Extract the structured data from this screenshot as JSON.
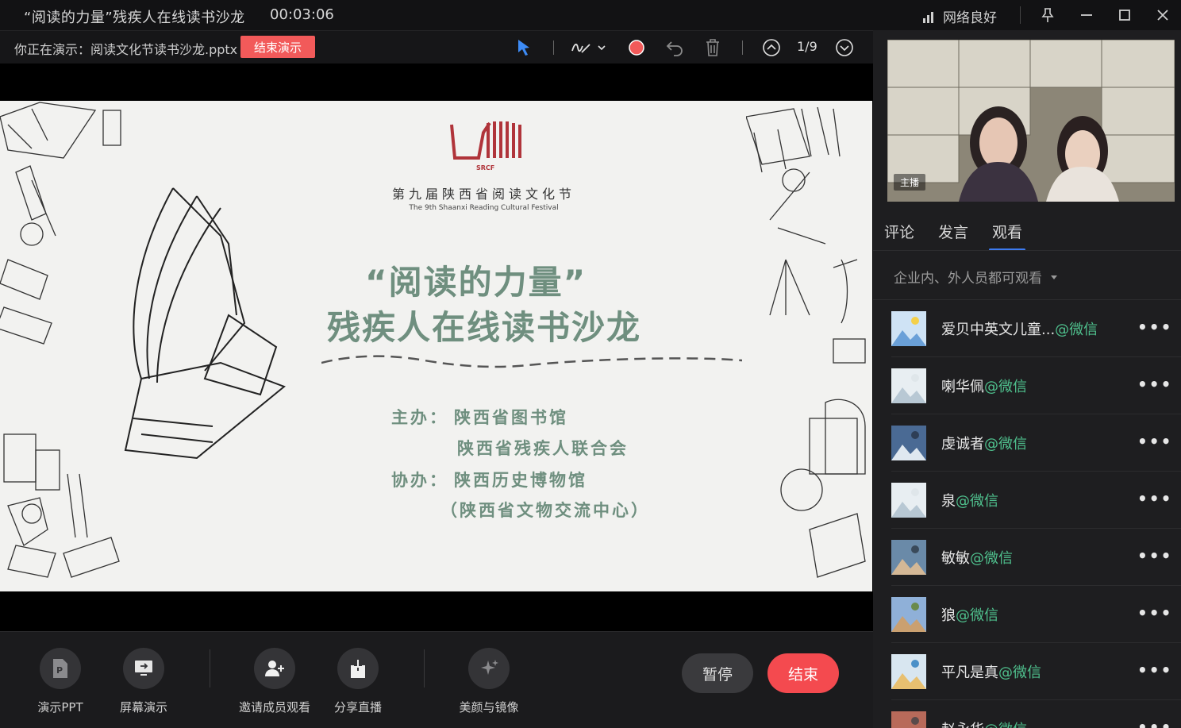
{
  "titlebar": {
    "title": "“阅读的力量”残疾人在线读书沙龙",
    "time": "00:03:06",
    "network": "网络良好"
  },
  "toolbar": {
    "presenting": "你正在演示：阅读文化节读书沙龙.pptx",
    "end_present": "结束演示",
    "page": "1/9",
    "record_color": "#f25a5a"
  },
  "slide": {
    "logo_abbr": "SRCF",
    "festival_cn": "第九届陕西省阅读文化节",
    "festival_en": "The 9th Shaanxi Reading Cultural Festival",
    "title_line1": "“阅读的力量”",
    "title_line2": "残疾人在线读书沙龙",
    "host_label": "主办：",
    "host1": "陕西省图书馆",
    "host2": "陕西省残疾人联合会",
    "co_label": "协办：",
    "co1": "陕西历史博物馆",
    "co2": "（陕西省文物交流中心）",
    "accent_color": "#6f8f7f"
  },
  "controls": {
    "ppt": "演示PPT",
    "screen": "屏幕演示",
    "invite": "邀请成员观看",
    "share": "分享直播",
    "beauty": "美颜与镜像",
    "pause": "暂停",
    "stop": "结束"
  },
  "panel": {
    "host_tag": "主播",
    "tabs": [
      "评论",
      "发言",
      "观看"
    ],
    "visibility": "企业内、外人员都可观看",
    "viewers": [
      {
        "name": "爱贝中英文儿童...",
        "source": "@微信"
      },
      {
        "name": "喇华佩",
        "source": "@微信"
      },
      {
        "name": "虔诚者",
        "source": "@微信"
      },
      {
        "name": "泉",
        "source": "@微信"
      },
      {
        "name": "敏敏",
        "source": "@微信"
      },
      {
        "name": "狼",
        "source": "@微信"
      },
      {
        "name": "平凡是真",
        "source": "@微信"
      },
      {
        "name": "赵永华",
        "source": "@微信"
      }
    ]
  }
}
